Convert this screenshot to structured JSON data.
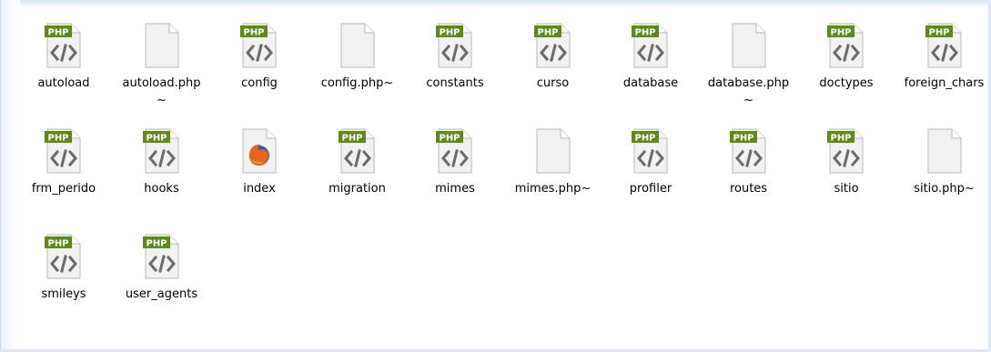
{
  "files": [
    {
      "name": "autoload",
      "icon": "php-file-icon",
      "badge": "PHP"
    },
    {
      "name": "autoload.php~",
      "icon": "blank-file-icon"
    },
    {
      "name": "config",
      "icon": "php-file-icon",
      "badge": "PHP"
    },
    {
      "name": "config.php~",
      "icon": "blank-file-icon"
    },
    {
      "name": "constants",
      "icon": "php-file-icon",
      "badge": "PHP"
    },
    {
      "name": "curso",
      "icon": "php-file-icon",
      "badge": "PHP"
    },
    {
      "name": "database",
      "icon": "php-file-icon",
      "badge": "PHP"
    },
    {
      "name": "database.php~",
      "icon": "blank-file-icon"
    },
    {
      "name": "doctypes",
      "icon": "php-file-icon",
      "badge": "PHP"
    },
    {
      "name": "foreign_chars",
      "icon": "php-file-icon",
      "badge": "PHP"
    },
    {
      "name": "frm_perido",
      "icon": "php-file-icon",
      "badge": "PHP"
    },
    {
      "name": "hooks",
      "icon": "php-file-icon",
      "badge": "PHP"
    },
    {
      "name": "index",
      "icon": "firefox-html-icon"
    },
    {
      "name": "migration",
      "icon": "php-file-icon",
      "badge": "PHP"
    },
    {
      "name": "mimes",
      "icon": "php-file-icon",
      "badge": "PHP"
    },
    {
      "name": "mimes.php~",
      "icon": "blank-file-icon"
    },
    {
      "name": "profiler",
      "icon": "php-file-icon",
      "badge": "PHP"
    },
    {
      "name": "routes",
      "icon": "php-file-icon",
      "badge": "PHP"
    },
    {
      "name": "sitio",
      "icon": "php-file-icon",
      "badge": "PHP"
    },
    {
      "name": "sitio.php~",
      "icon": "blank-file-icon"
    },
    {
      "name": "smileys",
      "icon": "php-file-icon",
      "badge": "PHP"
    },
    {
      "name": "user_agents",
      "icon": "php-file-icon",
      "badge": "PHP"
    }
  ],
  "colors": {
    "php_badge": "#5e8a1c",
    "php_badge_text": "#ffffff",
    "file_body": "#f2f2f2",
    "file_border": "#b9b9b9",
    "code_glyph": "#6b6b6b"
  }
}
